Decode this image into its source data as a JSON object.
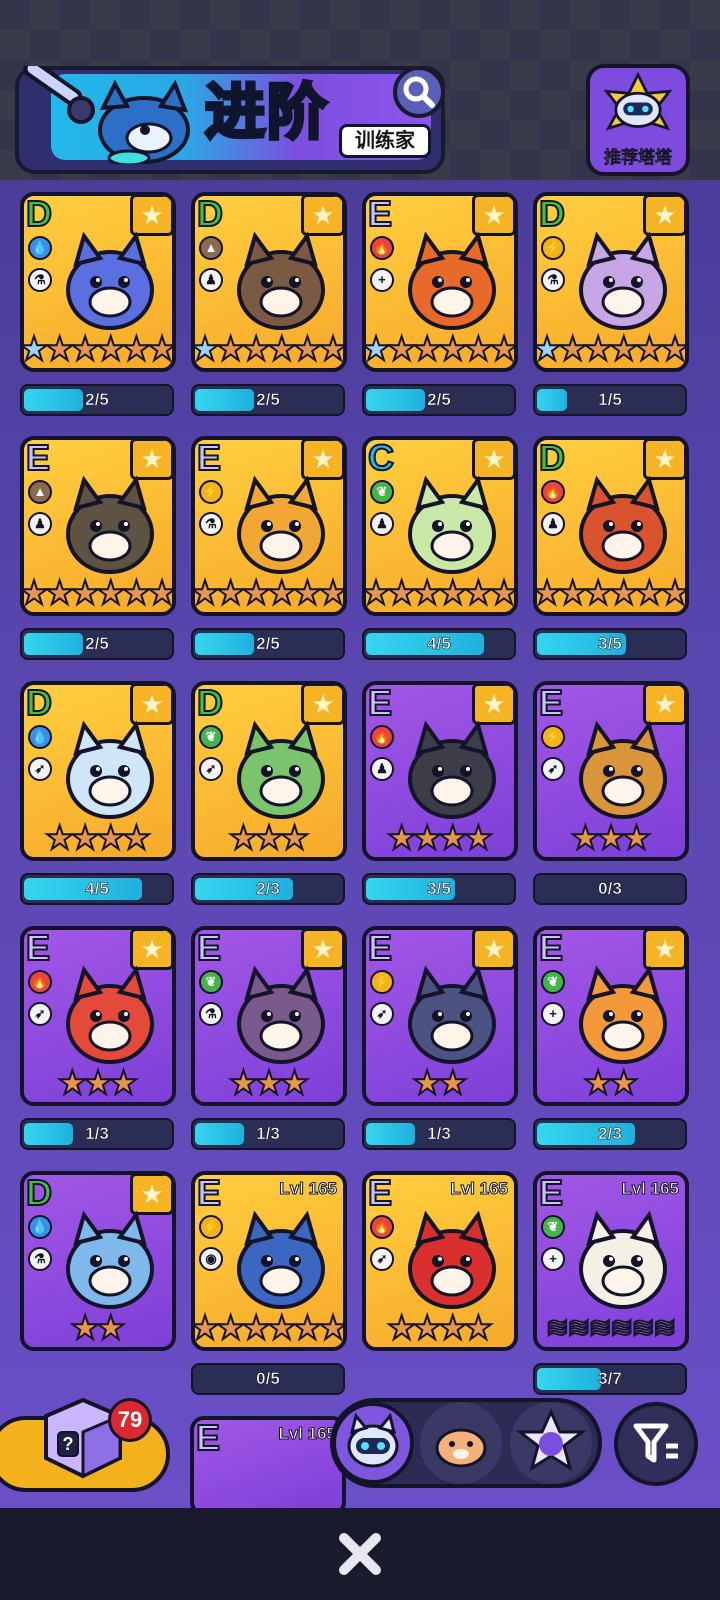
{
  "header": {
    "title": "进阶",
    "subtitle": "训练家"
  },
  "recommend": {
    "label": "推荐塔塔"
  },
  "cards": [
    {
      "grade": "D",
      "bg": "gold",
      "el": "water",
      "role": "flask",
      "stars": 6,
      "firstBlue": true,
      "progress": "2/5",
      "fill": 0.4,
      "color": "#5b6fe0"
    },
    {
      "grade": "D",
      "bg": "gold",
      "el": "earth",
      "role": "person",
      "stars": 6,
      "firstBlue": true,
      "progress": "2/5",
      "fill": 0.4,
      "color": "#7a5a42"
    },
    {
      "grade": "E",
      "bg": "gold",
      "el": "fire",
      "role": "plus",
      "stars": 6,
      "firstBlue": true,
      "progress": "2/5",
      "fill": 0.4,
      "color": "#e86a2a"
    },
    {
      "grade": "D",
      "bg": "gold",
      "el": "thunder",
      "role": "flask",
      "stars": 6,
      "firstBlue": true,
      "progress": "1/5",
      "fill": 0.2,
      "color": "#c7a6e6"
    },
    {
      "grade": "E",
      "bg": "gold",
      "el": "earth",
      "role": "person",
      "stars": 6,
      "firstBlue": false,
      "progress": "2/5",
      "fill": 0.4,
      "color": "#5e5243"
    },
    {
      "grade": "E",
      "bg": "gold",
      "el": "thunder",
      "role": "flask",
      "stars": 6,
      "firstBlue": false,
      "progress": "2/5",
      "fill": 0.4,
      "color": "#f2a634"
    },
    {
      "grade": "C",
      "bg": "gold",
      "el": "grass",
      "role": "person",
      "stars": 6,
      "firstBlue": false,
      "progress": "4/5",
      "fill": 0.8,
      "color": "#c9e8a8"
    },
    {
      "grade": "D",
      "bg": "gold",
      "el": "fire",
      "role": "person",
      "stars": 6,
      "firstBlue": false,
      "progress": "3/5",
      "fill": 0.6,
      "color": "#d9542e"
    },
    {
      "grade": "D",
      "bg": "gold",
      "el": "water",
      "role": "sprint",
      "stars": 4,
      "firstBlue": false,
      "progress": "4/5",
      "fill": 0.8,
      "color": "#cfe6f7"
    },
    {
      "grade": "D",
      "bg": "gold",
      "el": "grass",
      "role": "sprint",
      "stars": 3,
      "firstBlue": false,
      "progress": "2/3",
      "fill": 0.66,
      "color": "#7bc46b"
    },
    {
      "grade": "E",
      "bg": "purple",
      "el": "fire",
      "role": "person",
      "stars": 4,
      "firstBlue": false,
      "progress": "3/5",
      "fill": 0.6,
      "color": "#3d3d4a"
    },
    {
      "grade": "E",
      "bg": "purple",
      "el": "thunder",
      "role": "sprint",
      "stars": 3,
      "firstBlue": false,
      "progress": "0/3",
      "fill": 0,
      "color": "#d9953a"
    },
    {
      "grade": "E",
      "bg": "purple",
      "el": "fire",
      "role": "sprint",
      "stars": 3,
      "firstBlue": false,
      "progress": "1/3",
      "fill": 0.33,
      "color": "#e44a3a"
    },
    {
      "grade": "E",
      "bg": "purple",
      "el": "grass",
      "role": "flask",
      "stars": 3,
      "firstBlue": false,
      "progress": "1/3",
      "fill": 0.33,
      "color": "#7a5a8c"
    },
    {
      "grade": "E",
      "bg": "purple",
      "el": "thunder",
      "role": "sprint",
      "stars": 2,
      "firstBlue": false,
      "progress": "1/3",
      "fill": 0.33,
      "color": "#4c5282"
    },
    {
      "grade": "E",
      "bg": "purple",
      "el": "grass",
      "role": "plus",
      "stars": 2,
      "firstBlue": false,
      "progress": "2/3",
      "fill": 0.66,
      "color": "#f29a3a"
    },
    {
      "grade": "D",
      "bg": "purple",
      "el": "water",
      "role": "flask",
      "stars": 2,
      "firstBlue": false,
      "progress": "",
      "fill": 0.3,
      "color": "#7fb8ea"
    },
    {
      "grade": "E",
      "bg": "gold",
      "el": "thunder",
      "role": "eye",
      "stars": 6,
      "firstBlue": false,
      "lvl": "Lvl 165",
      "progress": "0/5",
      "fill": 0,
      "color": "#3b66c2"
    },
    {
      "grade": "E",
      "bg": "gold",
      "el": "fire",
      "role": "sprint",
      "stars": 4,
      "firstBlue": false,
      "lvl": "Lvl 165",
      "progress": "",
      "fill": 0.3,
      "color": "#d9302e"
    },
    {
      "grade": "E",
      "bg": "purple",
      "el": "grass",
      "role": "plus",
      "stars": 0,
      "waves": 6,
      "firstBlue": false,
      "lvl": "Lvl 165",
      "progress": "3/7",
      "fill": 0.43,
      "color": "#f4f0e6"
    }
  ],
  "partialCards": [
    {
      "grade": "E",
      "bg": "purple",
      "lvl": "Lvl 165"
    }
  ],
  "gift": {
    "count": "79"
  },
  "colors": {
    "gold": "#f7a92a",
    "purple": "#8a47dd",
    "bar": "#2ad0ec"
  }
}
